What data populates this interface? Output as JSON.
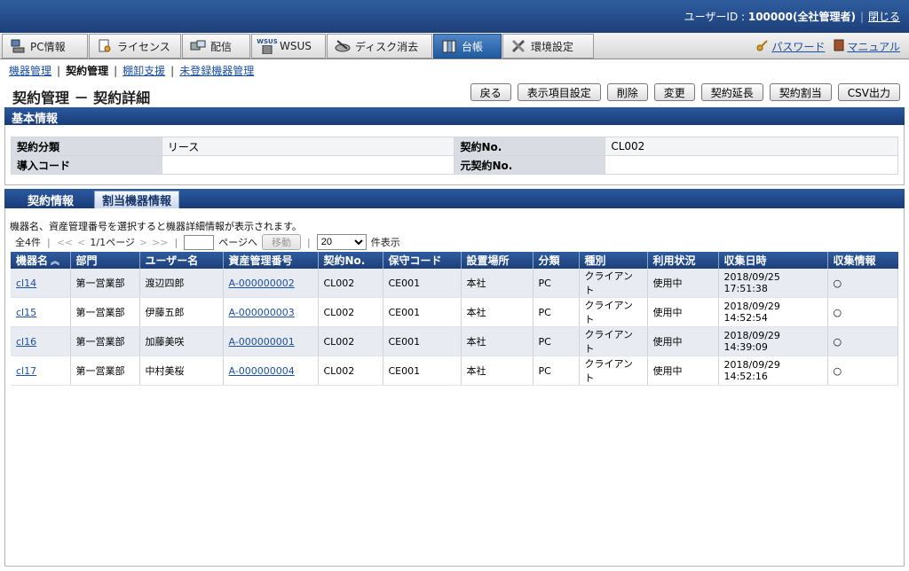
{
  "header": {
    "user_label": "ユーザーID : ",
    "user_id": "100000(全社管理者)",
    "close_label": "閉じる"
  },
  "tabs": [
    {
      "label": "PC情報",
      "icon": "pc-icon"
    },
    {
      "label": "ライセンス",
      "icon": "license-icon"
    },
    {
      "label": "配信",
      "icon": "distribution-icon"
    },
    {
      "label": "WSUS",
      "icon": "wsus-icon",
      "icon_text": "WSUS"
    },
    {
      "label": "ディスク消去",
      "icon": "disk-erase-icon"
    },
    {
      "label": "台帳",
      "icon": "ledger-icon"
    },
    {
      "label": "環境設定",
      "icon": "settings-icon"
    }
  ],
  "toplinks": {
    "password": "パスワード",
    "manual": "マニュアル"
  },
  "subnav": {
    "device_mgmt": "機器管理",
    "contract_mgmt": "契約管理",
    "inventory": "棚卸支援",
    "unregistered": "未登録機器管理"
  },
  "page_title": "契約管理 － 契約詳細",
  "buttons": {
    "back": "戻る",
    "display_settings": "表示項目設定",
    "delete": "削除",
    "change": "変更",
    "extend": "契約延長",
    "assign": "契約割当",
    "csv": "CSV出力"
  },
  "basic_info": {
    "section_title": "基本情報",
    "contract_type_label": "契約分類",
    "contract_type_value": "リース",
    "contract_no_label": "契約No.",
    "contract_no_value": "CL002",
    "intro_code_label": "導入コード",
    "intro_code_value": "",
    "orig_contract_no_label": "元契約No.",
    "orig_contract_no_value": ""
  },
  "detail_tabs": {
    "contract_info": "契約情報",
    "assigned_devices": "割当機器情報"
  },
  "hint": "機器名、資産管理番号を選択すると機器詳細情報が表示されます。",
  "pager": {
    "total": "全4件",
    "first": "<<",
    "prev": "<",
    "page_info": "1/1ページ",
    "next": ">",
    "last": ">>",
    "goto_label": "ページへ",
    "move_button": "移動",
    "per_page": "20",
    "per_page_suffix": "件表示"
  },
  "table": {
    "columns": [
      "機器名",
      "部門",
      "ユーザー名",
      "資産管理番号",
      "契約No.",
      "保守コード",
      "設置場所",
      "分類",
      "種別",
      "利用状況",
      "収集日時",
      "収集情報"
    ],
    "rows": [
      [
        "cl14",
        "第一営業部",
        "渡辺四郎",
        "A-000000002",
        "CL002",
        "CE001",
        "本社",
        "PC",
        "クライアント",
        "使用中",
        "2018/09/25 17:51:38",
        "○"
      ],
      [
        "cl15",
        "第一営業部",
        "伊藤五郎",
        "A-000000003",
        "CL002",
        "CE001",
        "本社",
        "PC",
        "クライアント",
        "使用中",
        "2018/09/29 14:52:54",
        "○"
      ],
      [
        "cl16",
        "第一営業部",
        "加藤美咲",
        "A-000000001",
        "CL002",
        "CE001",
        "本社",
        "PC",
        "クライアント",
        "使用中",
        "2018/09/29 14:39:09",
        "○"
      ],
      [
        "cl17",
        "第一営業部",
        "中村美桜",
        "A-000000004",
        "CL002",
        "CE001",
        "本社",
        "PC",
        "クライアント",
        "使用中",
        "2018/09/29 14:52:16",
        "○"
      ]
    ]
  }
}
